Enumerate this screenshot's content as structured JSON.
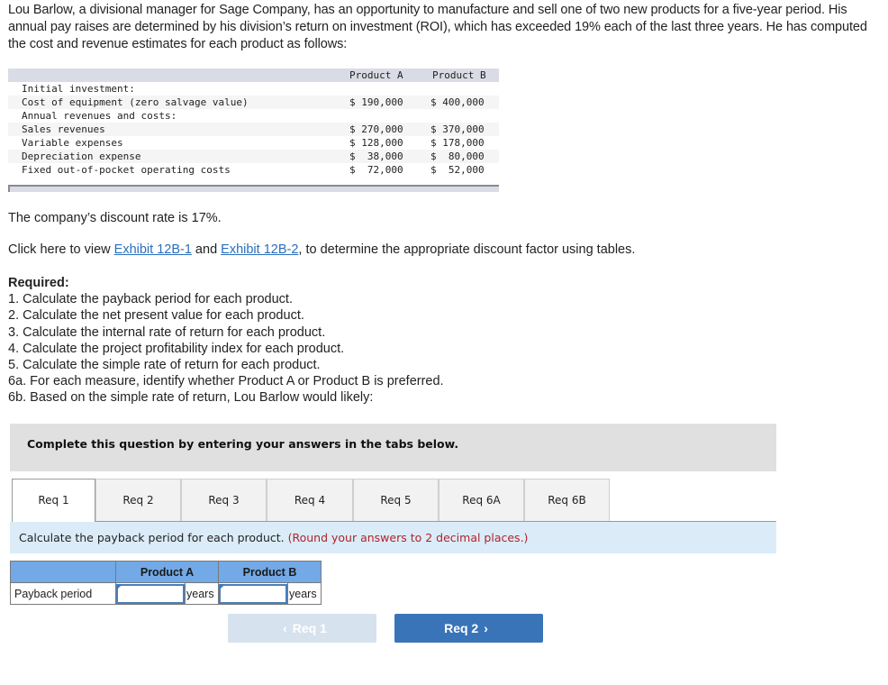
{
  "intro": "Lou Barlow, a divisional manager for Sage Company, has an opportunity to manufacture and sell one of two new products for a five-year period. His annual pay raises are determined by his division’s return on investment (ROI), which has exceeded 19% each of the last three years. He has computed the cost and revenue estimates for each product as follows:",
  "data_table": {
    "headers": [
      "Product A",
      "Product B"
    ],
    "rows": [
      {
        "label": "Initial investment:",
        "a": "",
        "b": ""
      },
      {
        "label": "Cost of equipment (zero salvage value)",
        "a": "$ 190,000",
        "b": "$ 400,000"
      },
      {
        "label": "Annual revenues and costs:",
        "a": "",
        "b": ""
      },
      {
        "label": "Sales revenues",
        "a": "$ 270,000",
        "b": "$ 370,000"
      },
      {
        "label": "Variable expenses",
        "a": "$ 128,000",
        "b": "$ 178,000"
      },
      {
        "label": "Depreciation expense",
        "a": "$  38,000",
        "b": "$  80,000"
      },
      {
        "label": "Fixed out-of-pocket operating costs",
        "a": "$  72,000",
        "b": "$  52,000"
      }
    ]
  },
  "discount_text": "The company’s discount rate is 17%.",
  "exhibit_line": {
    "prefix": "Click here to view ",
    "link1": "Exhibit 12B-1",
    "middle": " and ",
    "link2": "Exhibit 12B-2",
    "suffix": ", to determine the appropriate discount factor using tables."
  },
  "required": {
    "title": "Required:",
    "items": [
      "1. Calculate the payback period for each product.",
      "2. Calculate the net present value for each product.",
      "3. Calculate the internal rate of return for each product.",
      "4. Calculate the project profitability index for each product.",
      "5. Calculate the simple rate of return for each product.",
      "6a. For each measure, identify whether Product A or Product B is preferred.",
      "6b. Based on the simple rate of return, Lou Barlow would likely:"
    ]
  },
  "banner": "Complete this question by entering your answers in the tabs below.",
  "tabs": [
    {
      "label": "Req 1",
      "active": true
    },
    {
      "label": "Req 2",
      "active": false
    },
    {
      "label": "Req 3",
      "active": false
    },
    {
      "label": "Req 4",
      "active": false
    },
    {
      "label": "Req 5",
      "active": false
    },
    {
      "label": "Req 6A",
      "active": false
    },
    {
      "label": "Req 6B",
      "active": false
    }
  ],
  "instruction": {
    "text": "Calculate the payback period for each product. ",
    "note": "(Round your answers to 2 decimal places.)"
  },
  "answer_table": {
    "col_a": "Product A",
    "col_b": "Product B",
    "row_label": "Payback period",
    "value_a": "",
    "value_b": "",
    "unit": "years"
  },
  "nav": {
    "prev_label": "Req 1",
    "next_label": "Req 2",
    "prev_icon": "chevron-left-icon",
    "next_icon": "chevron-right-icon"
  }
}
